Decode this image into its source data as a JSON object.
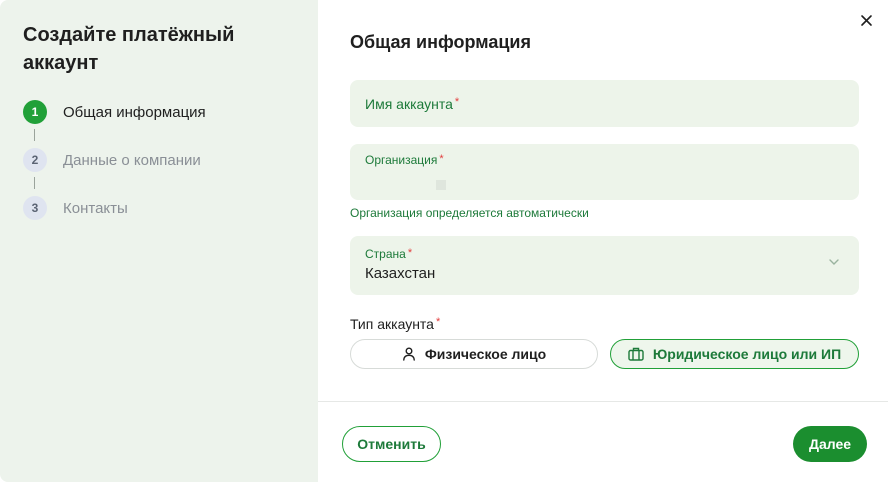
{
  "sidebar": {
    "title": "Создайте платёжный аккаунт",
    "steps": [
      {
        "number": "1",
        "label": "Общая информация",
        "state": "active"
      },
      {
        "number": "2",
        "label": "Данные о компании",
        "state": "inactive"
      },
      {
        "number": "3",
        "label": "Контакты",
        "state": "inactive"
      }
    ]
  },
  "main": {
    "section_title": "Общая информация",
    "account_name": {
      "label": "Имя аккаунта",
      "required_mark": "*",
      "value": ""
    },
    "organization": {
      "label": "Организация",
      "required_mark": "*",
      "value": "",
      "hint": "Организация определяется автоматически"
    },
    "country": {
      "label": "Страна",
      "required_mark": "*",
      "value": "Казахстан"
    },
    "account_type": {
      "label": "Тип аккаунта",
      "required_mark": "*",
      "options": [
        {
          "label": "Физическое лицо",
          "icon": "person-icon",
          "selected": false
        },
        {
          "label": "Юридическое лицо или ИП",
          "icon": "briefcase-icon",
          "selected": true
        }
      ]
    }
  },
  "footer": {
    "cancel_label": "Отменить",
    "next_label": "Далее"
  },
  "colors": {
    "accent": "#21a038",
    "accent_dark": "#1b8e2f",
    "sidebar_bg": "#edf3ec",
    "field_bg": "#edf4ea",
    "required": "#e23d3d"
  }
}
